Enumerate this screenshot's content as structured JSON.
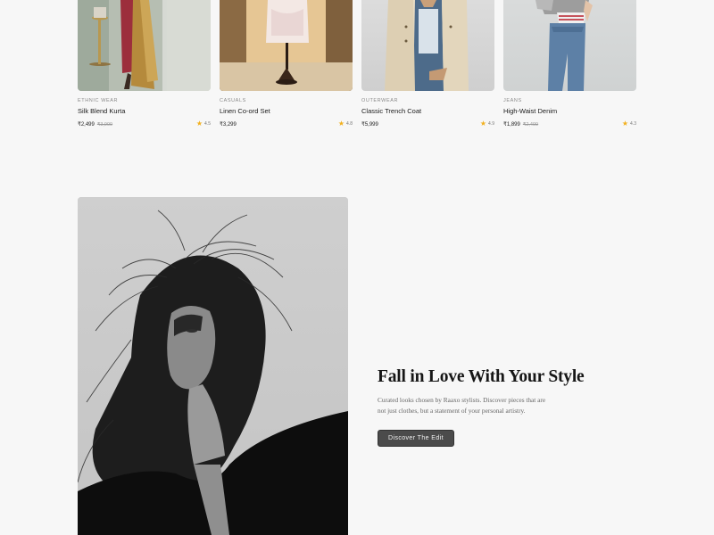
{
  "products": [
    {
      "category": "ETHNIC WEAR",
      "name": "Silk Blend Kurta",
      "price": "₹2,499",
      "old_price": "₹3,999",
      "rating": "4.5"
    },
    {
      "category": "CASUALS",
      "name": "Linen Co-ord Set",
      "price": "₹3,299",
      "old_price": "",
      "rating": "4.8"
    },
    {
      "category": "OUTERWEAR",
      "name": "Classic Trench Coat",
      "price": "₹5,999",
      "old_price": "",
      "rating": "4.9"
    },
    {
      "category": "JEANS",
      "name": "High-Waist Denim",
      "price": "₹1,899",
      "old_price": "₹2,499",
      "rating": "4.3"
    }
  ],
  "feature": {
    "title": "Fall in Love With Your Style",
    "description": "Curated looks chosen by Raaxo stylists. Discover pieces that are not just clothes, but a statement of your personal artistry.",
    "cta_label": "Discover The Edit"
  },
  "colors": {
    "background": "#f7f7f7",
    "star": "#f2b01e",
    "cta_background": "#4b4b4b"
  }
}
